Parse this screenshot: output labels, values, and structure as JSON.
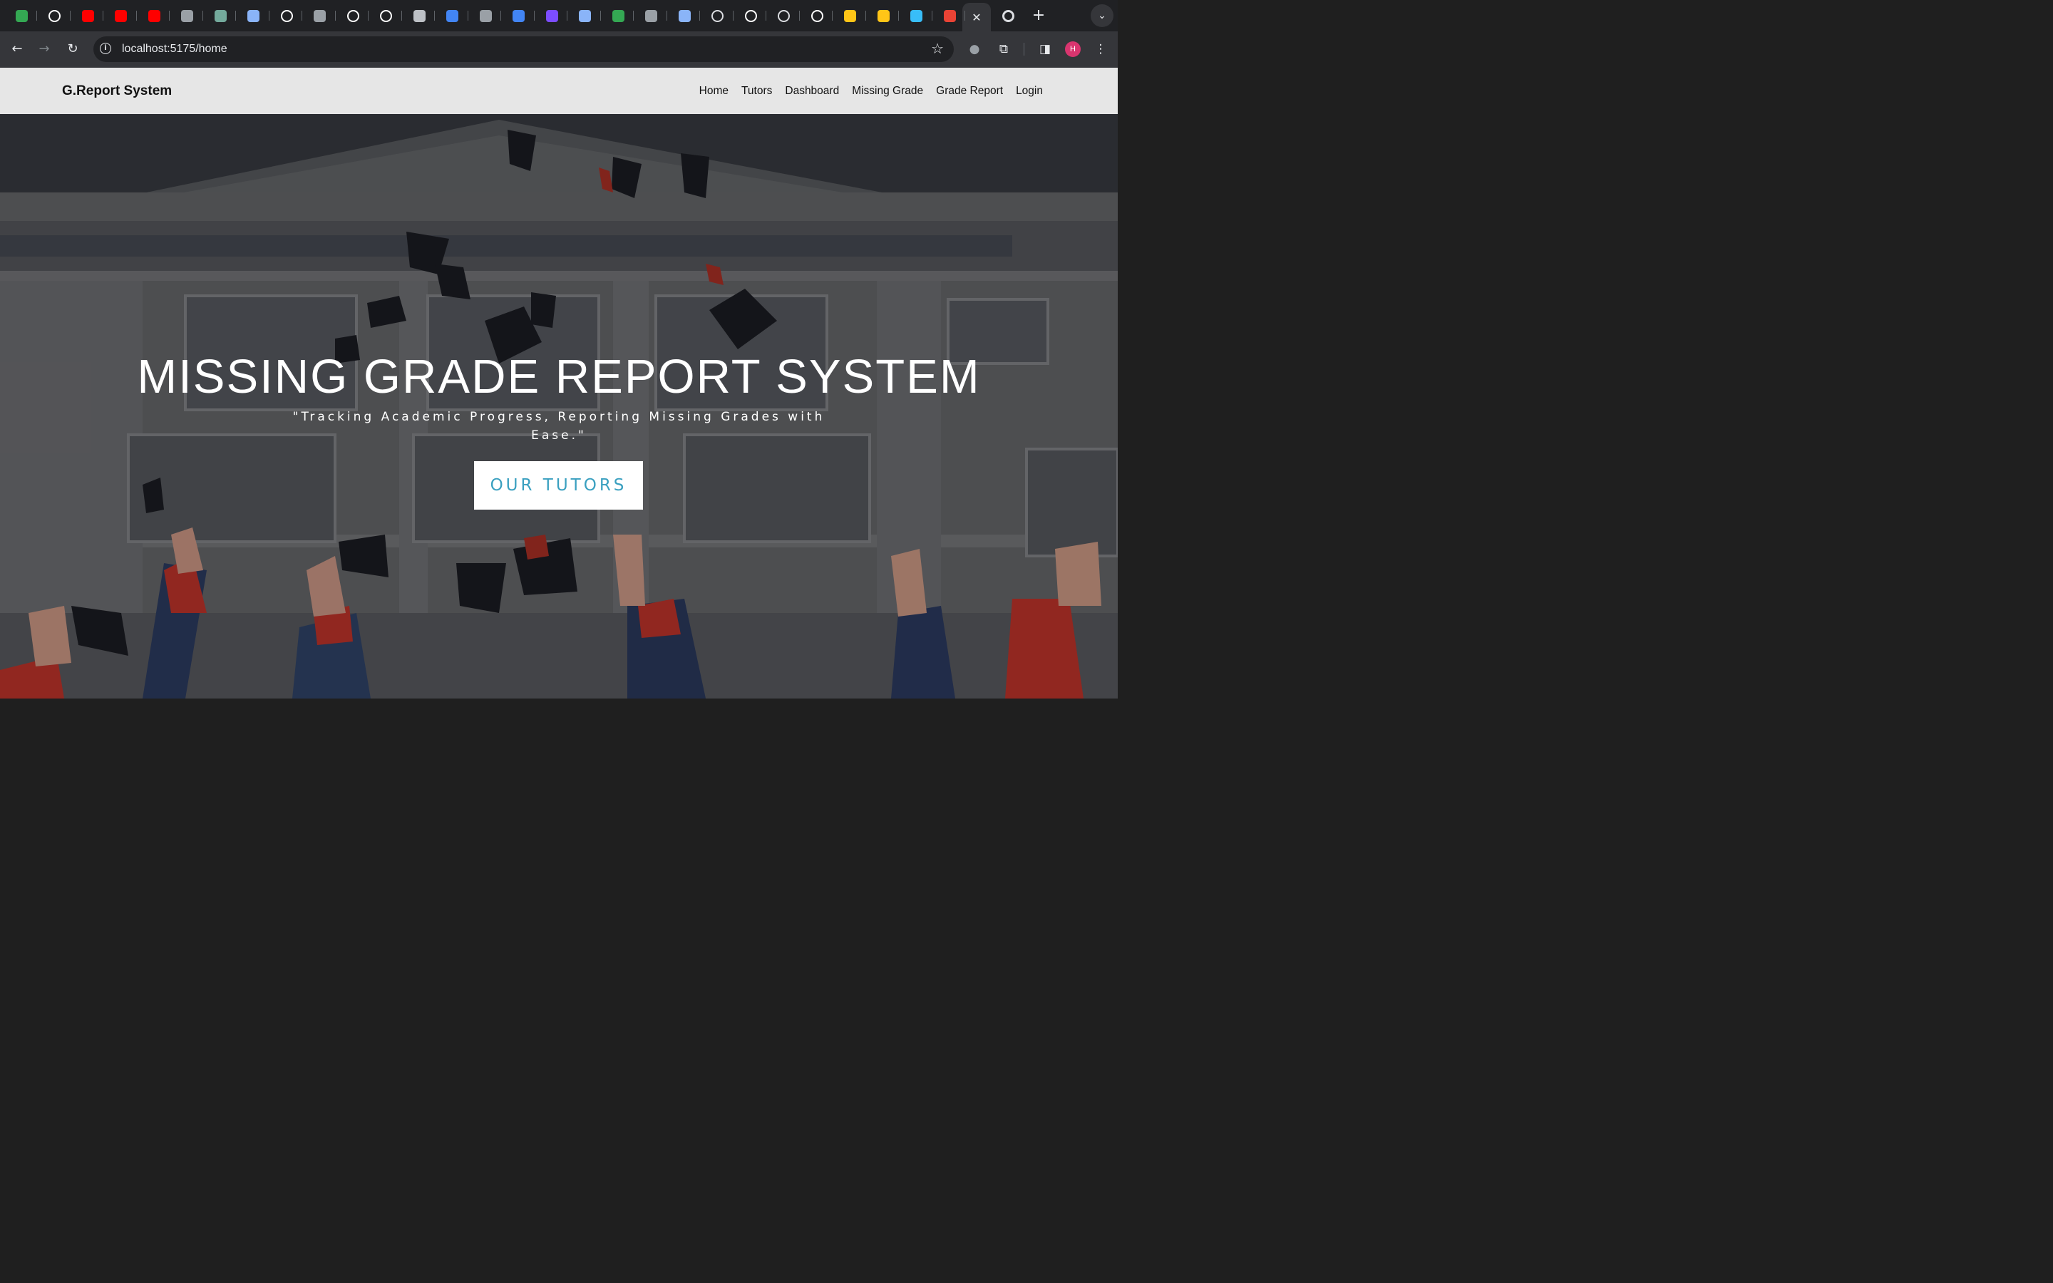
{
  "browser": {
    "tabs": [
      {
        "icon": "google-meet-icon",
        "color": "#34a853"
      },
      {
        "icon": "github-icon",
        "color": "#ffffff"
      },
      {
        "icon": "youtube-icon",
        "color": "#ff0000"
      },
      {
        "icon": "youtube-icon",
        "color": "#ff0000"
      },
      {
        "icon": "youtube-icon",
        "color": "#ff0000"
      },
      {
        "icon": "circle-app-icon",
        "color": "#9aa0a6"
      },
      {
        "icon": "chatgpt-icon",
        "color": "#74aa9c"
      },
      {
        "icon": "list-app-icon",
        "color": "#8ab4f8"
      },
      {
        "icon": "github-icon",
        "color": "#ffffff"
      },
      {
        "icon": "square-app-icon",
        "color": "#9aa0a6"
      },
      {
        "icon": "notion-icon",
        "color": "#ffffff"
      },
      {
        "icon": "unsplash-icon",
        "color": "#ffffff"
      },
      {
        "icon": "wave-icon",
        "color": "#bdc1c6"
      },
      {
        "icon": "google-icon",
        "color": "#4285f4"
      },
      {
        "icon": "leaf-icon",
        "color": "#9aa0a6"
      },
      {
        "icon": "google-icon",
        "color": "#4285f4"
      },
      {
        "icon": "list-purple-icon",
        "color": "#7c4dff"
      },
      {
        "icon": "refresh-app-icon",
        "color": "#8ab4f8"
      },
      {
        "icon": "w-icon",
        "color": "#34a853"
      },
      {
        "icon": "circle-app-icon",
        "color": "#9aa0a6"
      },
      {
        "icon": "circle-app-icon",
        "color": "#8ab4f8"
      },
      {
        "icon": "target-icon",
        "color": "#dadce0"
      },
      {
        "icon": "unsplash-icon",
        "color": "#ffffff"
      },
      {
        "icon": "target-icon",
        "color": "#dadce0"
      },
      {
        "icon": "github-icon",
        "color": "#ffffff"
      },
      {
        "icon": "vite-icon",
        "color": "#ffc517"
      },
      {
        "icon": "vite-icon",
        "color": "#ffc517"
      },
      {
        "icon": "tailwind-icon",
        "color": "#38bdf8"
      },
      {
        "icon": "gauge-icon",
        "color": "#ea4335"
      }
    ],
    "url": "localhost:5175/home",
    "profile_initial": "H"
  },
  "site": {
    "brand": "G.Report System",
    "nav": [
      "Home",
      "Tutors",
      "Dashboard",
      "Missing Grade",
      "Grade Report",
      "Login"
    ]
  },
  "hero": {
    "title": "MISSING GRADE REPORT SYSTEM",
    "subtitle": "\"Tracking Academic Progress, Reporting Missing Grades with Ease.\"",
    "cta_label": "OUR TUTORS",
    "accent_color": "#3aa0c0"
  }
}
